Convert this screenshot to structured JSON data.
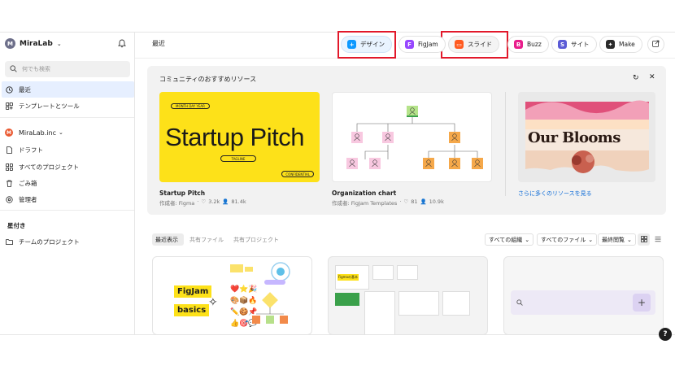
{
  "sidebar": {
    "workspace_initial": "M",
    "workspace_name": "MiraLab",
    "search_placeholder": "何でも検索",
    "nav": [
      {
        "label": "最近",
        "active": true,
        "icon": "clock-icon"
      },
      {
        "label": "テンプレートとツール",
        "active": false,
        "icon": "templates-icon"
      }
    ],
    "org": {
      "initial": "M",
      "name": "MiraLab.inc"
    },
    "org_items": [
      {
        "label": "ドラフト",
        "icon": "file-icon"
      },
      {
        "label": "すべてのプロジェクト",
        "icon": "grid-icon"
      },
      {
        "label": "ごみ箱",
        "icon": "trash-icon"
      },
      {
        "label": "管理者",
        "icon": "admin-icon"
      }
    ],
    "starred_heading": "星付き",
    "starred_items": [
      {
        "label": "チームのプロジェクト",
        "icon": "folder-icon"
      }
    ]
  },
  "header": {
    "title": "最近",
    "chips": [
      {
        "label": "デザイン",
        "color": "#0d99ff",
        "glyph": "+"
      },
      {
        "label": "FigJam",
        "color": "#9747ff",
        "glyph": "F"
      },
      {
        "label": "スライド",
        "color": "#ff5a1f",
        "glyph": "▭"
      },
      {
        "label": "Buzz",
        "color": "#e91e8c",
        "glyph": "B"
      },
      {
        "label": "サイト",
        "color": "#5b5bd6",
        "glyph": "S"
      },
      {
        "label": "Make",
        "color": "#2b2b2b",
        "glyph": "✦"
      }
    ]
  },
  "community": {
    "title": "コミュニティのおすすめリソース",
    "cards": [
      {
        "title": "Startup Pitch",
        "author": "作成者: Figma",
        "likes": "3.2k",
        "users": "81.4k",
        "image": {
          "heading": "Startup Pitch",
          "pill_top": "MONTH DAY YEAR",
          "pill_mid": "TAGLINE",
          "pill_corner": "CONFIDENTIAL",
          "bg": "#fde119"
        }
      },
      {
        "title": "Organization chart",
        "author": "作成者: FigJam Templates",
        "likes": "81",
        "users": "10.9k"
      },
      {
        "image_text": "Our Blooms",
        "link": "さらに多くのリソースを見る"
      }
    ]
  },
  "files": {
    "tabs": [
      "最近表示",
      "共有ファイル",
      "共有プロジェクト"
    ],
    "filters": [
      "すべての組織",
      "すべてのファイル",
      "最終閲覧"
    ],
    "cards": [
      {
        "title_top": "FigJam",
        "title_bottom": "basics"
      },
      {
        "title": "Figmaの基本"
      },
      {
        "plus": "+"
      }
    ]
  },
  "help": "?"
}
